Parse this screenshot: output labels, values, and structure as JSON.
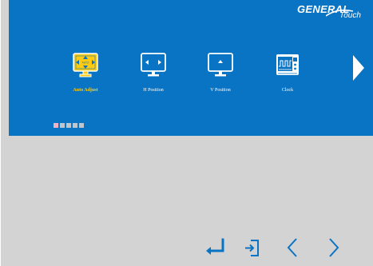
{
  "brand": {
    "line1": "GENERAL",
    "line2": "Touch"
  },
  "menu": {
    "items": [
      {
        "label": "Auto Adjust",
        "icon": "auto-adjust-icon",
        "active": true,
        "inner_text": "AUTO"
      },
      {
        "label": "H Position",
        "icon": "h-position-icon",
        "active": false
      },
      {
        "label": "V Position",
        "icon": "v-position-icon",
        "active": false
      },
      {
        "label": "Clock",
        "icon": "clock-icon",
        "active": false
      }
    ],
    "next": "next-page-arrow-icon"
  },
  "pager": {
    "pages": 5,
    "current": 1
  },
  "controls": [
    {
      "name": "enter-button",
      "icon": "enter-icon"
    },
    {
      "name": "exit-button",
      "icon": "exit-icon"
    },
    {
      "name": "left-button",
      "icon": "chevron-left-icon"
    },
    {
      "name": "right-button",
      "icon": "chevron-right-icon"
    }
  ],
  "colors": {
    "panel": "#0a74c4",
    "background": "#d3d3d3",
    "active": "#ffcc11",
    "inactive_dot": "#bfc5cc",
    "active_dot": "#f3b2c4"
  }
}
